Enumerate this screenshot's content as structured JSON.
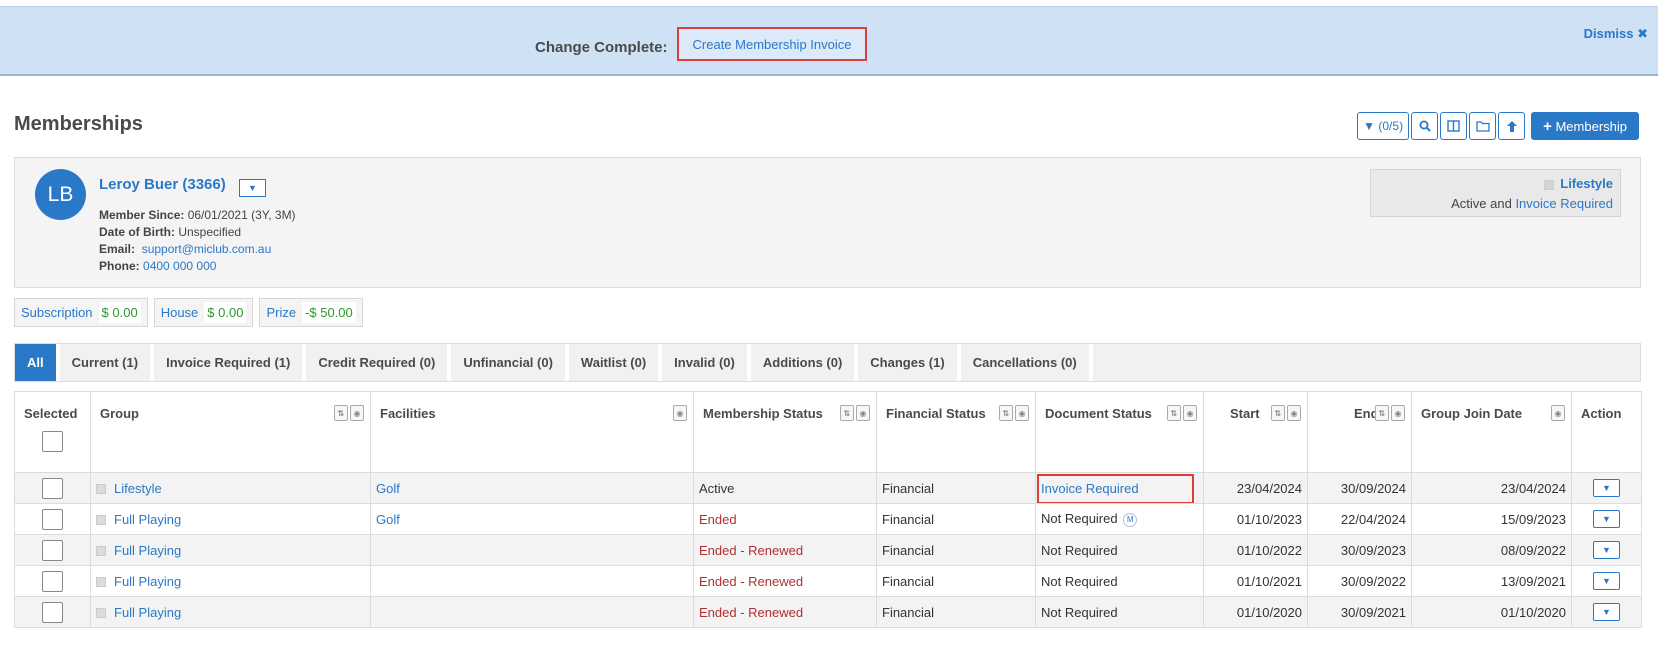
{
  "banner": {
    "label": "Change Complete:",
    "link": "Create Membership Invoice",
    "dismiss": "Dismiss"
  },
  "page": {
    "title": "Memberships"
  },
  "toolbar": {
    "filter_label": "(0/5)",
    "add_membership": "Membership"
  },
  "member": {
    "initials": "LB",
    "name": "Leroy Buer (3366)",
    "since_label": "Member Since:",
    "since_value": "06/01/2021 (3Y, 3M)",
    "dob_label": "Date of Birth:",
    "dob_value": "Unspecified",
    "email_label": "Email:",
    "email_value": "support@miclub.com.au",
    "phone_label": "Phone:",
    "phone_value": "0400 000 000",
    "status_group": "Lifestyle",
    "status_text": "Active and",
    "status_link": "Invoice Required"
  },
  "balances": [
    {
      "label": "Subscription",
      "value": "$ 0.00"
    },
    {
      "label": "House",
      "value": "$ 0.00"
    },
    {
      "label": "Prize",
      "value": "-$ 50.00"
    }
  ],
  "tabs": [
    "All",
    "Current (1)",
    "Invoice Required (1)",
    "Credit Required (0)",
    "Unfinancial (0)",
    "Waitlist (0)",
    "Invalid (0)",
    "Additions (0)",
    "Changes (1)",
    "Cancellations (0)"
  ],
  "table": {
    "headers": {
      "selected": "Selected",
      "group": "Group",
      "facilities": "Facilities",
      "membership_status": "Membership Status",
      "financial_status": "Financial Status",
      "document_status": "Document Status",
      "start": "Start",
      "end": "End",
      "group_join_date": "Group Join Date",
      "action": "Action"
    },
    "rows": [
      {
        "group": "Lifestyle",
        "facilities": "Golf",
        "membership_status": "Active",
        "financial_status": "Financial",
        "document_status": "Invoice Required",
        "start": "23/04/2024",
        "end": "30/09/2024",
        "join": "23/04/2024"
      },
      {
        "group": "Full Playing",
        "facilities": "Golf",
        "membership_status": "Ended",
        "financial_status": "Financial",
        "document_status": "Not Required",
        "doc_badge": "M",
        "start": "01/10/2023",
        "end": "22/04/2024",
        "join": "15/09/2023"
      },
      {
        "group": "Full Playing",
        "facilities": "",
        "membership_status": "Ended - Renewed",
        "financial_status": "Financial",
        "document_status": "Not Required",
        "start": "01/10/2022",
        "end": "30/09/2023",
        "join": "08/09/2022"
      },
      {
        "group": "Full Playing",
        "facilities": "",
        "membership_status": "Ended - Renewed",
        "financial_status": "Financial",
        "document_status": "Not Required",
        "start": "01/10/2021",
        "end": "30/09/2022",
        "join": "13/09/2021"
      },
      {
        "group": "Full Playing",
        "facilities": "",
        "membership_status": "Ended - Renewed",
        "financial_status": "Financial",
        "document_status": "Not Required",
        "start": "01/10/2020",
        "end": "30/09/2021",
        "join": "01/10/2020"
      }
    ]
  }
}
